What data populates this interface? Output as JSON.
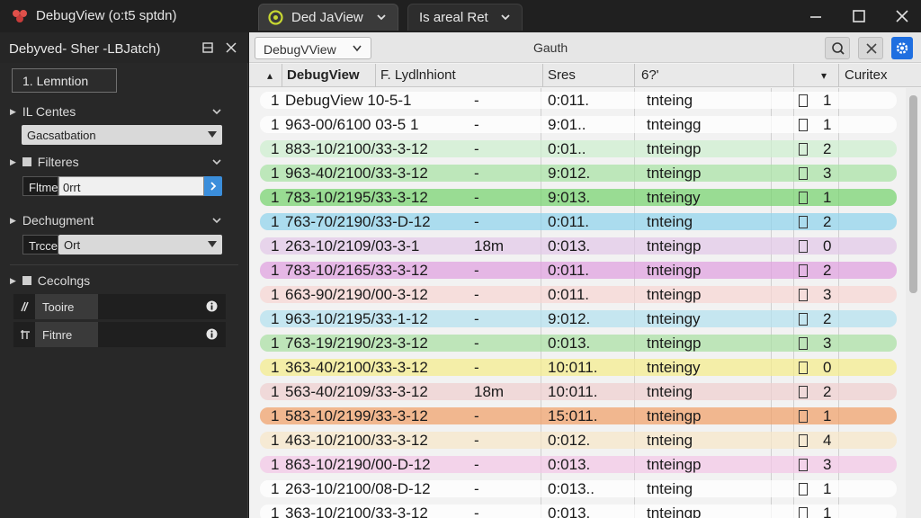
{
  "window": {
    "title": "DebugView (o:t5 sptdn)",
    "tabs": [
      {
        "label": "Ded JaView"
      },
      {
        "label": "Is areal Ret"
      }
    ]
  },
  "left_panel": {
    "title": "Debyved- Sher -LBJatch)",
    "button_label": "1. Lemntion",
    "sections": {
      "centres": {
        "label": "IL Centes",
        "select_value": "Gacsatbation"
      },
      "filters": {
        "label": "Filteres",
        "field_label": "Fltme",
        "field_value": "0rrt"
      },
      "debug": {
        "label": "Dechugment",
        "field_label": "Trcce",
        "select_value": "Ort"
      },
      "settings": {
        "label": "Cecolngs",
        "items": [
          {
            "label": "Tooire"
          },
          {
            "label": "Fitnre"
          }
        ]
      }
    }
  },
  "toolbar": {
    "view_select": "DebugVView",
    "title": "Gauth"
  },
  "grid": {
    "headers": {
      "sort": "▴",
      "name": "DebugView",
      "desc": "F. Lydlnhiont",
      "time": "Sres",
      "type": "6?'",
      "flag": "▾",
      "extra": "Curitex"
    },
    "rows": [
      {
        "num": "1",
        "name": "DebugView  10-5-1",
        "desc": "-",
        "time": "0:011.",
        "type": "tnteing",
        "count": "1",
        "color": "#ffffff"
      },
      {
        "num": "1",
        "name": "963-00/6100 03-5  1",
        "desc": "-",
        "time": "9:01..",
        "type": "tnteingg",
        "count": "1",
        "color": "#ffffff"
      },
      {
        "num": "1",
        "name": "883-10/2100/33-3-12",
        "desc": "-",
        "time": "0:01..",
        "type": "tnteingp",
        "count": "2",
        "color": "#cdeecf"
      },
      {
        "num": "1",
        "name": "963-40/2100/33-3-12",
        "desc": "-",
        "time": "9:012.",
        "type": "tnteingp",
        "count": "3",
        "color": "#a7e2a3"
      },
      {
        "num": "1",
        "name": "783-10/2195/33-3-12",
        "desc": "-",
        "time": "9:013.",
        "type": "tnteingy",
        "count": "1",
        "color": "#76d36d"
      },
      {
        "num": "1",
        "name": "763-70/2190/33-D-12",
        "desc": "-",
        "time": "0:011.",
        "type": "tnteing",
        "count": "2",
        "color": "#8fd3ec"
      },
      {
        "num": "1",
        "name": "263-10/2109/03-3-1",
        "desc": "18m",
        "time": "0:013.",
        "type": "tnteingp",
        "count": "0",
        "color": "#e2c8e8"
      },
      {
        "num": "1",
        "name": "783-10/2165/33-3-12",
        "desc": "-",
        "time": "0:011.",
        "type": "tnteingp",
        "count": "2",
        "color": "#df9fdf"
      },
      {
        "num": "1",
        "name": "663-90/2190/00-3-12",
        "desc": "-",
        "time": "0:011.",
        "type": "tnteingp",
        "count": "3",
        "color": "#f6d6d2"
      },
      {
        "num": "1",
        "name": "963-10/2195/33-1-12",
        "desc": "-",
        "time": "9:012.",
        "type": "tnteingy",
        "count": "2",
        "color": "#b3e0ee"
      },
      {
        "num": "1",
        "name": "763-19/2190/23-3-12",
        "desc": "-",
        "time": "0:013.",
        "type": "tnteingp",
        "count": "3",
        "color": "#a9dfa2"
      },
      {
        "num": "1",
        "name": "363-40/2100/33-3-12",
        "desc": "-",
        "time": "10:011.",
        "type": "tnteingy",
        "count": "0",
        "color": "#f4ec8a"
      },
      {
        "num": "1",
        "name": "563-40/2109/33-3-12",
        "desc": "18m",
        "time": "10:011.",
        "type": "tnteing",
        "count": "2",
        "color": "#efcfcf"
      },
      {
        "num": "1",
        "name": "583-10/2199/33-3-12",
        "desc": "-",
        "time": "15:011.",
        "type": "tnteingp",
        "count": "1",
        "color": "#f0a068"
      },
      {
        "num": "1",
        "name": "463-10/2100/33-3-12",
        "desc": "-",
        "time": "0:012.",
        "type": "tnteing",
        "count": "4",
        "color": "#f6e6c8"
      },
      {
        "num": "1",
        "name": "863-10/2190/00-D-12",
        "desc": "-",
        "time": "0:013.",
        "type": "tnteingp",
        "count": "3",
        "color": "#f2c6e6"
      },
      {
        "num": "1",
        "name": "263-10/2100/08-D-12",
        "desc": "-",
        "time": "0:013..",
        "type": "tnteing",
        "count": "1",
        "color": "#ffffff"
      },
      {
        "num": "1",
        "name": "363-10/2100/33-3-12",
        "desc": "-",
        "time": "0:013.",
        "type": "tnteingp",
        "count": "1",
        "color": "#ffffff"
      }
    ]
  },
  "colors": {
    "accent": "#1f6fe0",
    "titlebar": "#202020",
    "panel": "#282828"
  }
}
